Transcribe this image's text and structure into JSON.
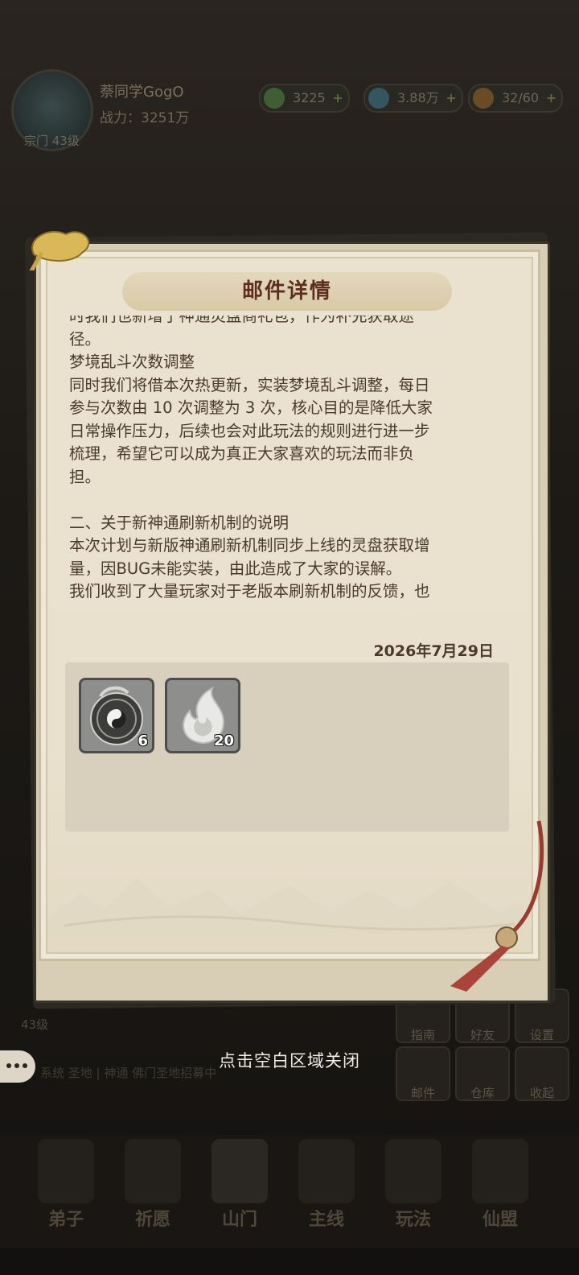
{
  "player": {
    "name": "萘同学GogO",
    "power": "战力：3251万",
    "level": "宗门 43级"
  },
  "resources": [
    {
      "value": "3225",
      "icon": "jade-icon",
      "color": "#4b7a3e"
    },
    {
      "value": "3.88万",
      "icon": "spirit-stone-icon",
      "color": "#3e6f7a"
    },
    {
      "value": "32/60",
      "icon": "peach-icon",
      "color": "#a86a2c"
    }
  ],
  "side_buttons": [
    "指南",
    "好友",
    "设置",
    "邮件",
    "仓库",
    "收起"
  ],
  "chat": {
    "text": "系统  圣地 | 神通  佛门圣地招募中"
  },
  "bottom_level": "43级",
  "nav": [
    {
      "label": "弟子"
    },
    {
      "label": "祈愿"
    },
    {
      "label": "山门"
    },
    {
      "label": "主线"
    },
    {
      "label": "玩法"
    },
    {
      "label": "仙盟"
    }
  ],
  "dialog": {
    "title": "邮件详情",
    "body_lines": [
      "时我们也新增了神通灵盘商礼包，作为补充获取途",
      "径。",
      "梦境乱斗次数调整",
      "同时我们将借本次热更新，实装梦境乱斗调整，每日",
      "参与次数由 10 次调整为 3 次，核心目的是降低大家",
      "日常操作压力，后续也会对此玩法的规则进行进一步",
      "梳理，希望它可以成为真正大家喜欢的玩法而非负",
      "担。",
      "",
      "二、关于新神通刷新机制的说明",
      "本次计划与新版神通刷新机制同步上线的灵盘获取增",
      "量，因BUG未能实装，由此造成了大家的误解。",
      "我们收到了大量玩家对于老版本刷新机制的反馈，也"
    ],
    "date": "2026年7月29日",
    "attachments": [
      {
        "icon": "taiji-disc-icon",
        "count": "6"
      },
      {
        "icon": "spirit-flame-icon",
        "count": "20"
      }
    ]
  },
  "close_hint": "点击空白区域关闭"
}
